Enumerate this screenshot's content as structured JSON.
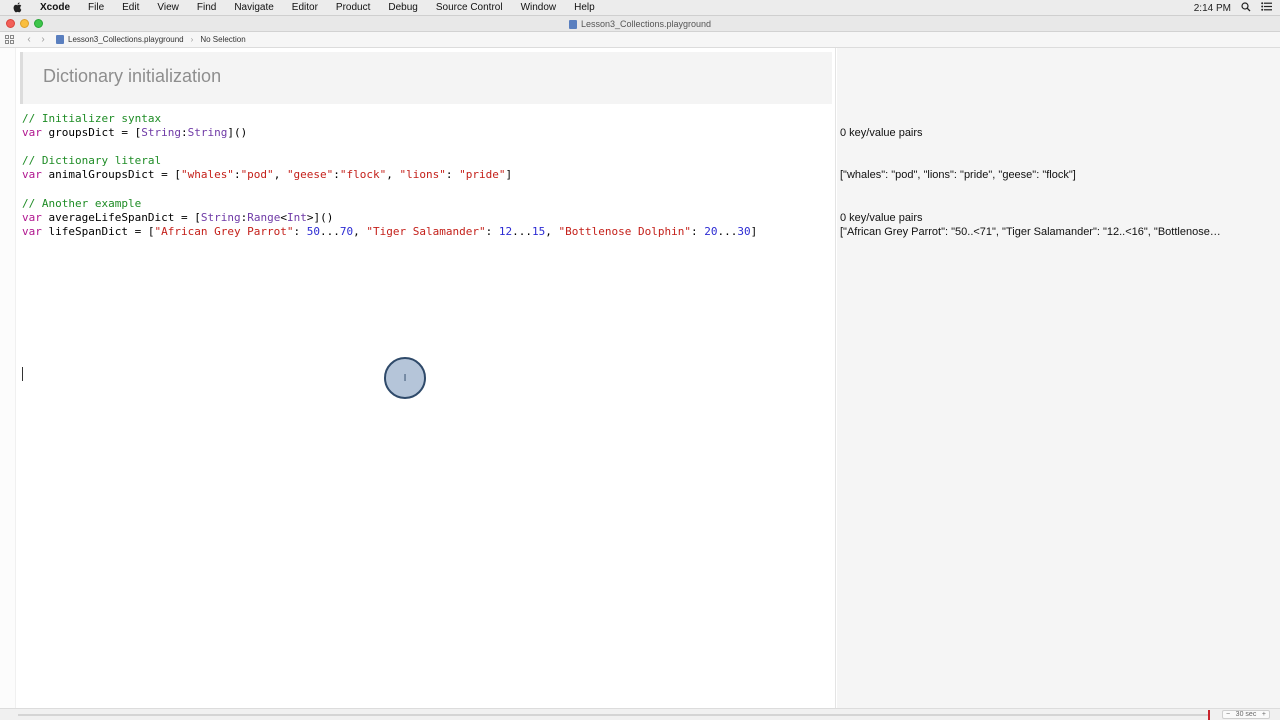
{
  "menubar": {
    "apple_icon": "apple-icon",
    "items": [
      "Xcode",
      "File",
      "Edit",
      "View",
      "Find",
      "Navigate",
      "Editor",
      "Product",
      "Debug",
      "Source Control",
      "Window",
      "Help"
    ],
    "clock": "2:14 PM"
  },
  "window": {
    "title": "Lesson3_Collections.playground"
  },
  "jumpbar": {
    "file": "Lesson3_Collections.playground",
    "selection": "No Selection"
  },
  "editor": {
    "markup_heading": "Dictionary initialization",
    "lines": {
      "l1": "// Initializer syntax",
      "l2_kw": "var",
      "l2_name": " groupsDict = [",
      "l2_t1": "String",
      "l2_colon": ":",
      "l2_t2": "String",
      "l2_end": "]()",
      "l3": "// Dictionary literal",
      "l4_kw": "var",
      "l4_name": " animalGroupsDict = [",
      "l4_s1": "\"whales\"",
      "l4_c1": ":",
      "l4_s2": "\"pod\"",
      "l4_c2": ", ",
      "l4_s3": "\"geese\"",
      "l4_c3": ":",
      "l4_s4": "\"flock\"",
      "l4_c4": ", ",
      "l4_s5": "\"lions\"",
      "l4_c5": ": ",
      "l4_s6": "\"pride\"",
      "l4_end": "]",
      "l5": "// Another example",
      "l6_kw": "var",
      "l6_name": " averageLifeSpanDict = [",
      "l6_t1": "String",
      "l6_colon": ":",
      "l6_t2": "Range",
      "l6_lt": "<",
      "l6_t3": "Int",
      "l6_end": ">]()",
      "l7_kw": "var",
      "l7_name": " lifeSpanDict = [",
      "l7_s1": "\"African Grey Parrot\"",
      "l7_c1": ": ",
      "l7_n1": "50",
      "l7_r1": "...",
      "l7_n2": "70",
      "l7_c2": ", ",
      "l7_s2": "\"Tiger Salamander\"",
      "l7_c3": ": ",
      "l7_n3": "12",
      "l7_r2": "...",
      "l7_n4": "15",
      "l7_c4": ", ",
      "l7_s3": "\"Bottlenose Dolphin\"",
      "l7_c5": ": ",
      "l7_n5": "20",
      "l7_r3": "...",
      "l7_n6": "30",
      "l7_end": "]"
    }
  },
  "results": {
    "r1": "0 key/value pairs",
    "r2": "[\"whales\": \"pod\", \"lions\": \"pride\", \"geese\": \"flock\"]",
    "r3": "0 key/value pairs",
    "r4": "[\"African Grey Parrot\": \"50..<71\", \"Tiger Salamander\": \"12..<16\", \"Bottlenose…"
  },
  "timeline": {
    "control_label": "30",
    "control_unit": "sec"
  },
  "colors": {
    "comment": "#1e8c25",
    "keyword": "#b0168f",
    "string": "#c4201a",
    "number": "#2c2bd3",
    "type": "#6f3aa6"
  }
}
